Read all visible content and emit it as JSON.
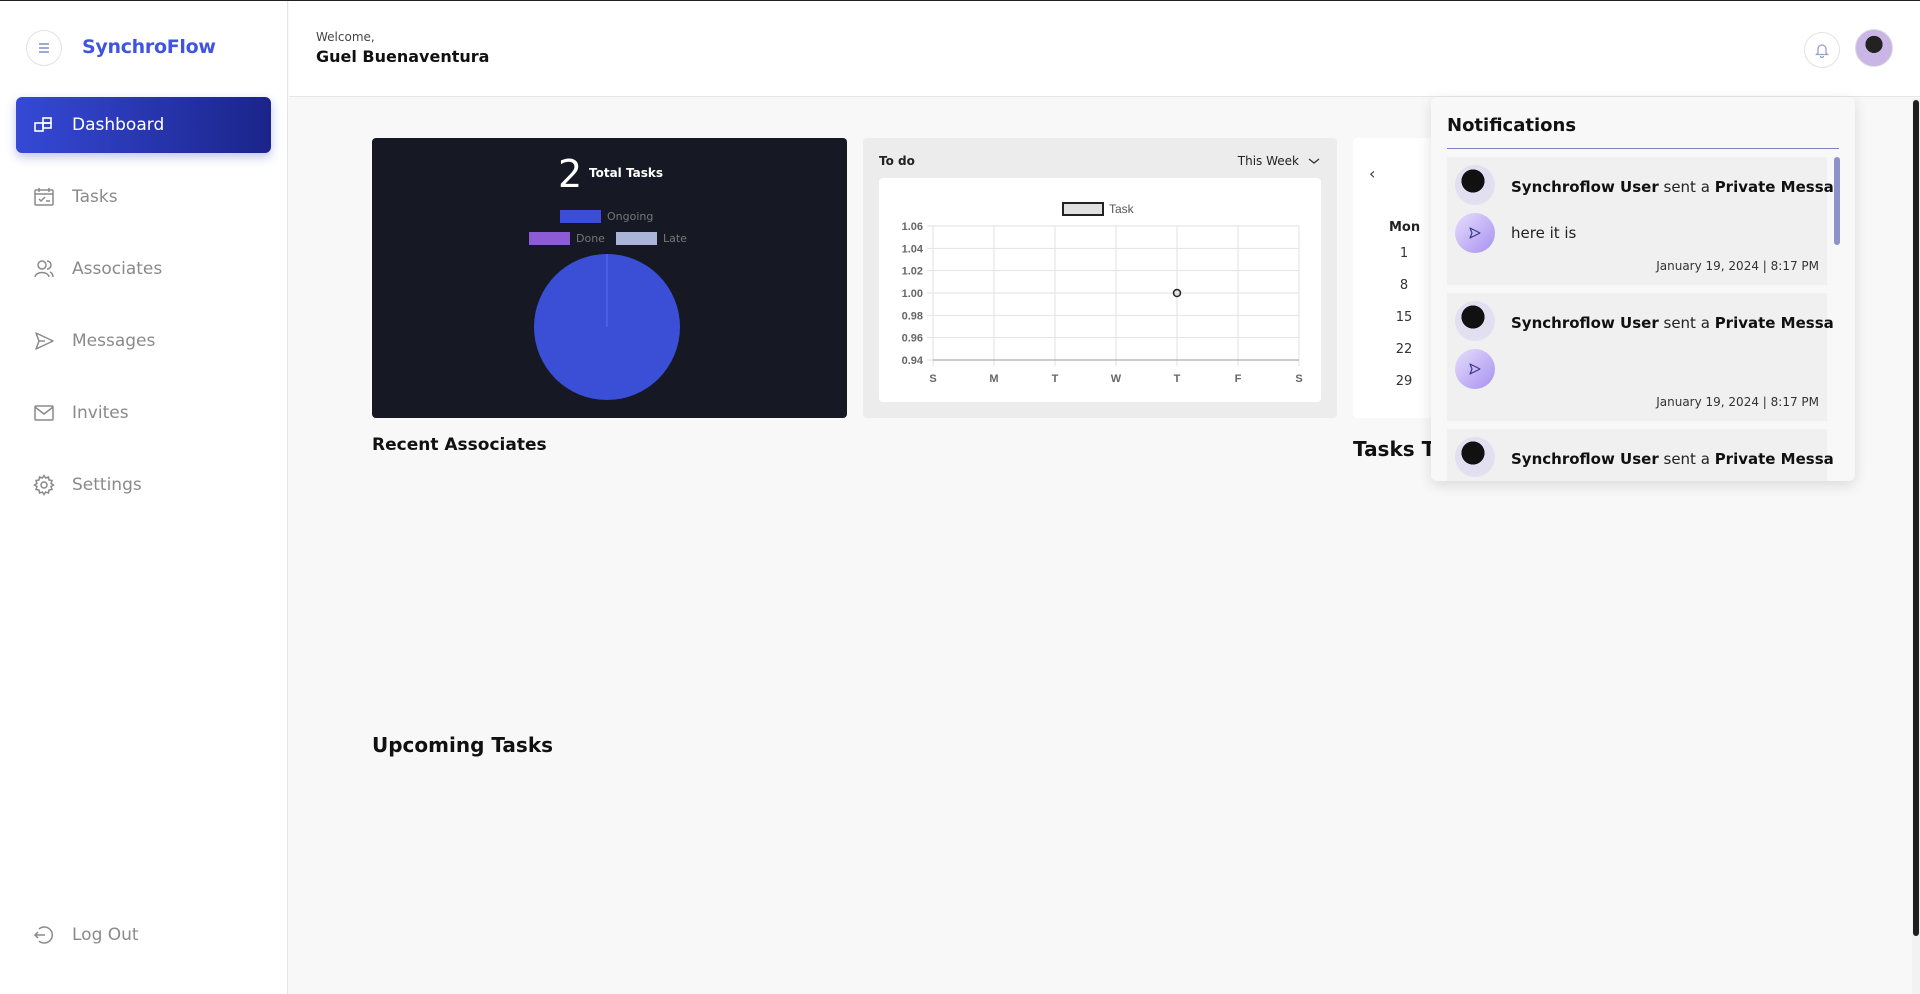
{
  "app": {
    "brand": "SynchroFlow"
  },
  "sidebar": {
    "items": [
      {
        "label": "Dashboard",
        "icon": "dashboard-icon",
        "active": true
      },
      {
        "label": "Tasks",
        "icon": "calendar-check-icon",
        "active": false
      },
      {
        "label": "Associates",
        "icon": "users-icon",
        "active": false
      },
      {
        "label": "Messages",
        "icon": "send-icon",
        "active": false
      },
      {
        "label": "Invites",
        "icon": "mail-icon",
        "active": false
      },
      {
        "label": "Settings",
        "icon": "gear-icon",
        "active": false
      }
    ],
    "logout": "Log Out"
  },
  "header": {
    "welcome": "Welcome,",
    "user": "Guel Buenaventura"
  },
  "summary": {
    "total_value": "2",
    "total_label": "Total Tasks",
    "legend": [
      {
        "label": "Ongoing",
        "color": "#3a4fd6"
      },
      {
        "label": "Done",
        "color": "#8b5cd6"
      },
      {
        "label": "Late",
        "color": "#aab4d8"
      }
    ]
  },
  "todo": {
    "title": "To do",
    "range": "This Week"
  },
  "calendar": {
    "day_header": "Mon",
    "dates": [
      "1",
      "8",
      "15",
      "22",
      "29"
    ]
  },
  "sections": {
    "recent_associates": "Recent Associates",
    "tasks_today": "Tasks To",
    "upcoming_tasks": "Upcoming Tasks"
  },
  "notifications": {
    "title": "Notifications",
    "items": [
      {
        "sender": "Synchroflow User",
        "verb": "sent a",
        "kind": "Private Message",
        "message": "here it is",
        "time": "January 19, 2024 | 8:17 PM"
      },
      {
        "sender": "Synchroflow User",
        "verb": "sent a",
        "kind": "Private Message",
        "message": "",
        "time": "January 19, 2024 | 8:17 PM"
      },
      {
        "sender": "Synchroflow User",
        "verb": "sent a",
        "kind": "Private Message",
        "message": "",
        "time": ""
      }
    ]
  },
  "chart_data": [
    {
      "type": "pie",
      "title": "",
      "categories": [
        "Ongoing",
        "Done",
        "Late"
      ],
      "values": [
        2,
        0,
        0
      ],
      "colors": [
        "#3a4fd6",
        "#8b5cd6",
        "#aab4d8"
      ],
      "legend": "top"
    },
    {
      "type": "line",
      "title": "",
      "categories": [
        "S",
        "M",
        "T",
        "W",
        "T",
        "F",
        "S"
      ],
      "series": [
        {
          "name": "Task",
          "values": [
            null,
            null,
            null,
            null,
            1,
            null,
            null
          ]
        }
      ],
      "ylim": [
        0.94,
        1.06
      ],
      "yticks": [
        "1.06",
        "1.04",
        "1.02",
        "1.00",
        "0.98",
        "0.96",
        "0.94"
      ],
      "grid": true,
      "legend": "top"
    }
  ]
}
